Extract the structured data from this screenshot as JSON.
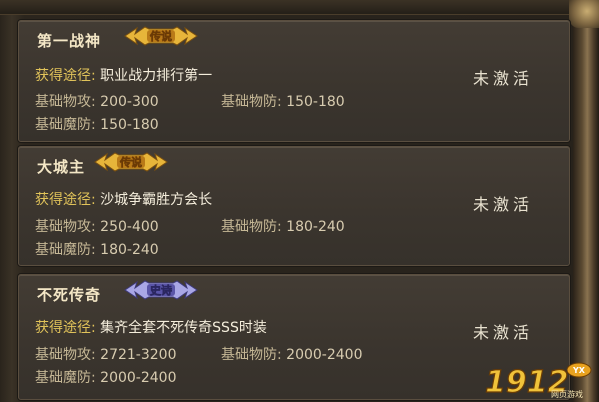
{
  "cards": [
    {
      "title": "第一战神",
      "badge": "传说",
      "source_label": "获得途径:",
      "source": "职业战力排行第一",
      "attack_label": "基础物攻:",
      "attack": "200-300",
      "defense_label": "基础物防:",
      "defense": "150-180",
      "magic_label": "基础魔防:",
      "magic": "150-180",
      "status": "未激活"
    },
    {
      "title": "大城主",
      "badge": "传说",
      "source_label": "获得途径:",
      "source": "沙城争霸胜方会长",
      "attack_label": "基础物攻:",
      "attack": "250-400",
      "defense_label": "基础物防:",
      "defense": "180-240",
      "magic_label": "基础魔防:",
      "magic": "180-240",
      "status": "未激活"
    },
    {
      "title": "不死传奇",
      "badge": "史诗",
      "source_label": "获得途径:",
      "source": "集齐全套不死传奇SSS时装",
      "attack_label": "基础物攻:",
      "attack": "2721-3200",
      "defense_label": "基础物防:",
      "defense": "2000-2400",
      "magic_label": "基础魔防:",
      "magic": "2000-2400",
      "status": "未激活"
    }
  ],
  "watermark": {
    "main": "1912",
    "tag": "YX",
    "sub": "网页游戏"
  },
  "colors": {
    "legend_badge": "#e7b53a",
    "epic_badge": "#a9a7e6",
    "label_gold": "#e1c35a"
  }
}
